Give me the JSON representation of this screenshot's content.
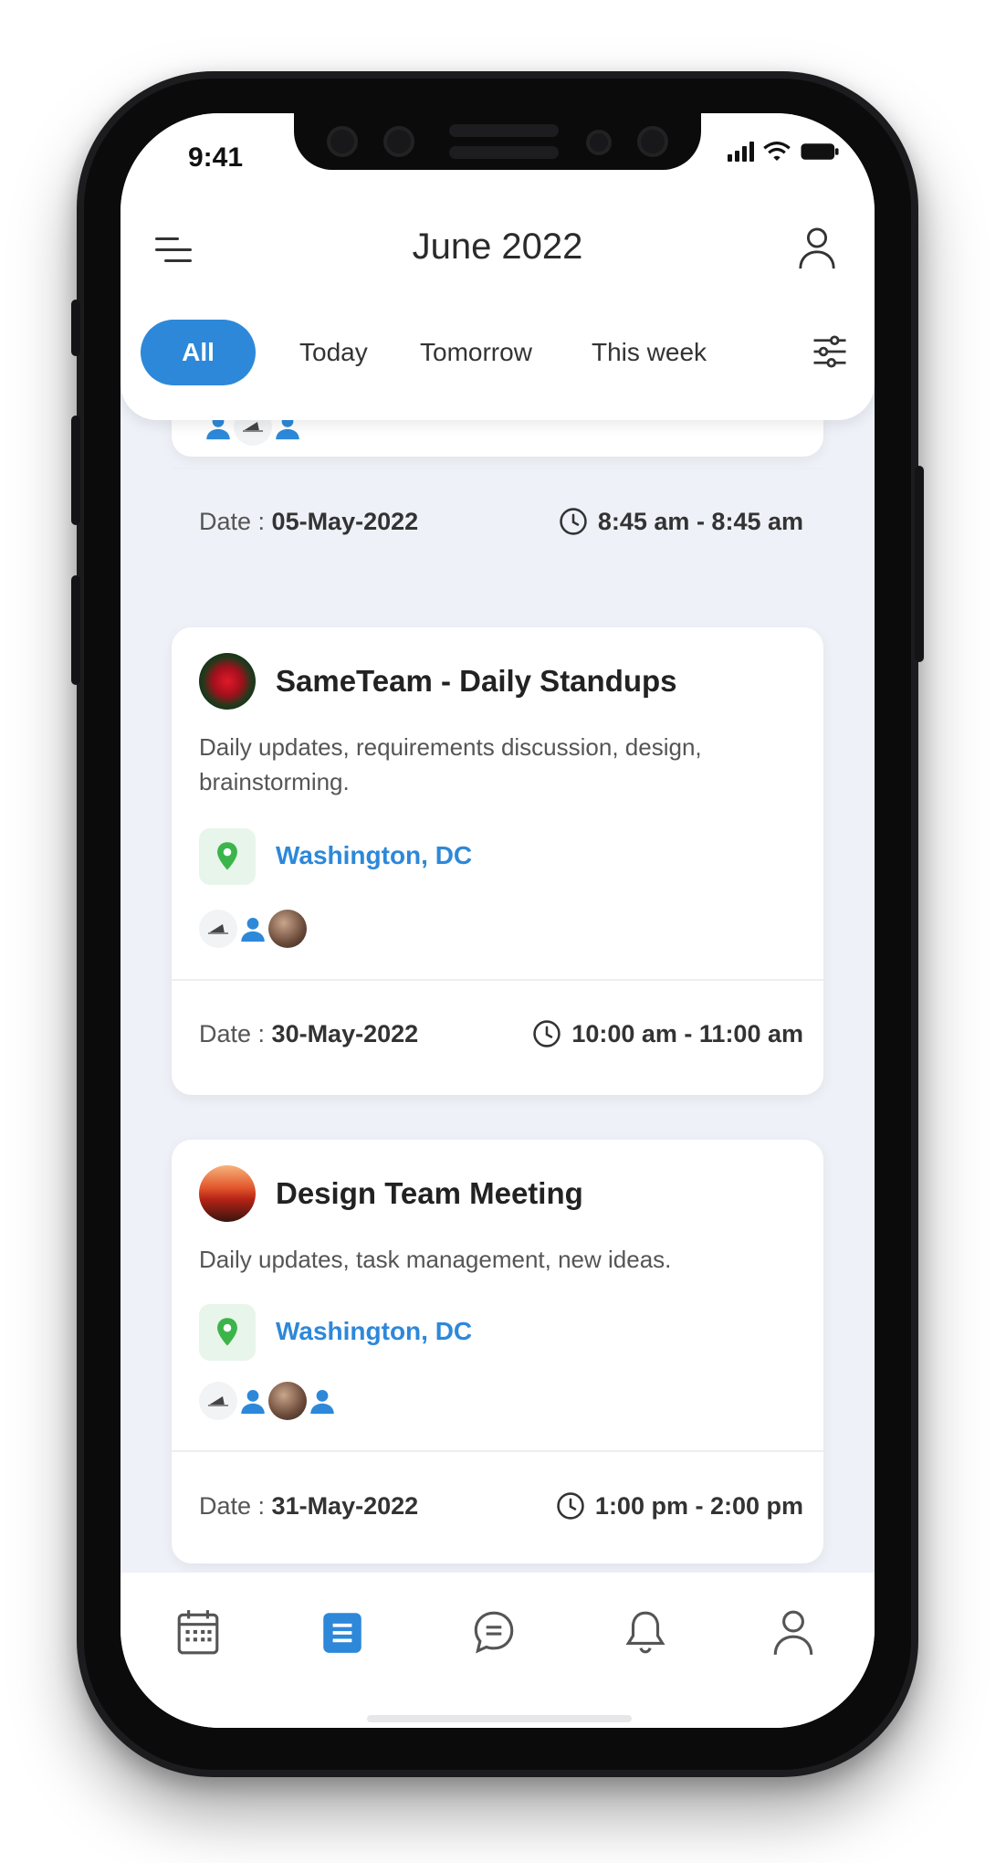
{
  "status_bar": {
    "time": "9:41"
  },
  "header": {
    "title": "June 2022",
    "tabs": [
      {
        "label": "All",
        "active": true
      },
      {
        "label": "Today",
        "active": false
      },
      {
        "label": "Tomorrow",
        "active": false
      },
      {
        "label": "This week",
        "active": false
      }
    ]
  },
  "colors": {
    "accent": "#2d88d9",
    "location_green": "#3bb54a",
    "background": "#eef1f7"
  },
  "events": [
    {
      "date_label": "Date : ",
      "date": "05-May-2022",
      "time": "8:45 am - 8:45 am"
    },
    {
      "title": "SameTeam - Daily Standups",
      "description": "Daily updates, requirements discussion, design, brainstorming.",
      "location": "Washington, DC",
      "date_label": "Date : ",
      "date": "30-May-2022",
      "time": "10:00 am - 11:00 am"
    },
    {
      "title": "Design Team Meeting",
      "description": "Daily updates, task management, new ideas.",
      "location": "Washington, DC",
      "date_label": "Date : ",
      "date": "31-May-2022",
      "time": "1:00 pm - 2:00 pm"
    }
  ],
  "bottom_nav": [
    {
      "icon": "calendar-icon",
      "active": false
    },
    {
      "icon": "list-icon",
      "active": true
    },
    {
      "icon": "chat-icon",
      "active": false
    },
    {
      "icon": "bell-icon",
      "active": false
    },
    {
      "icon": "profile-icon",
      "active": false
    }
  ]
}
